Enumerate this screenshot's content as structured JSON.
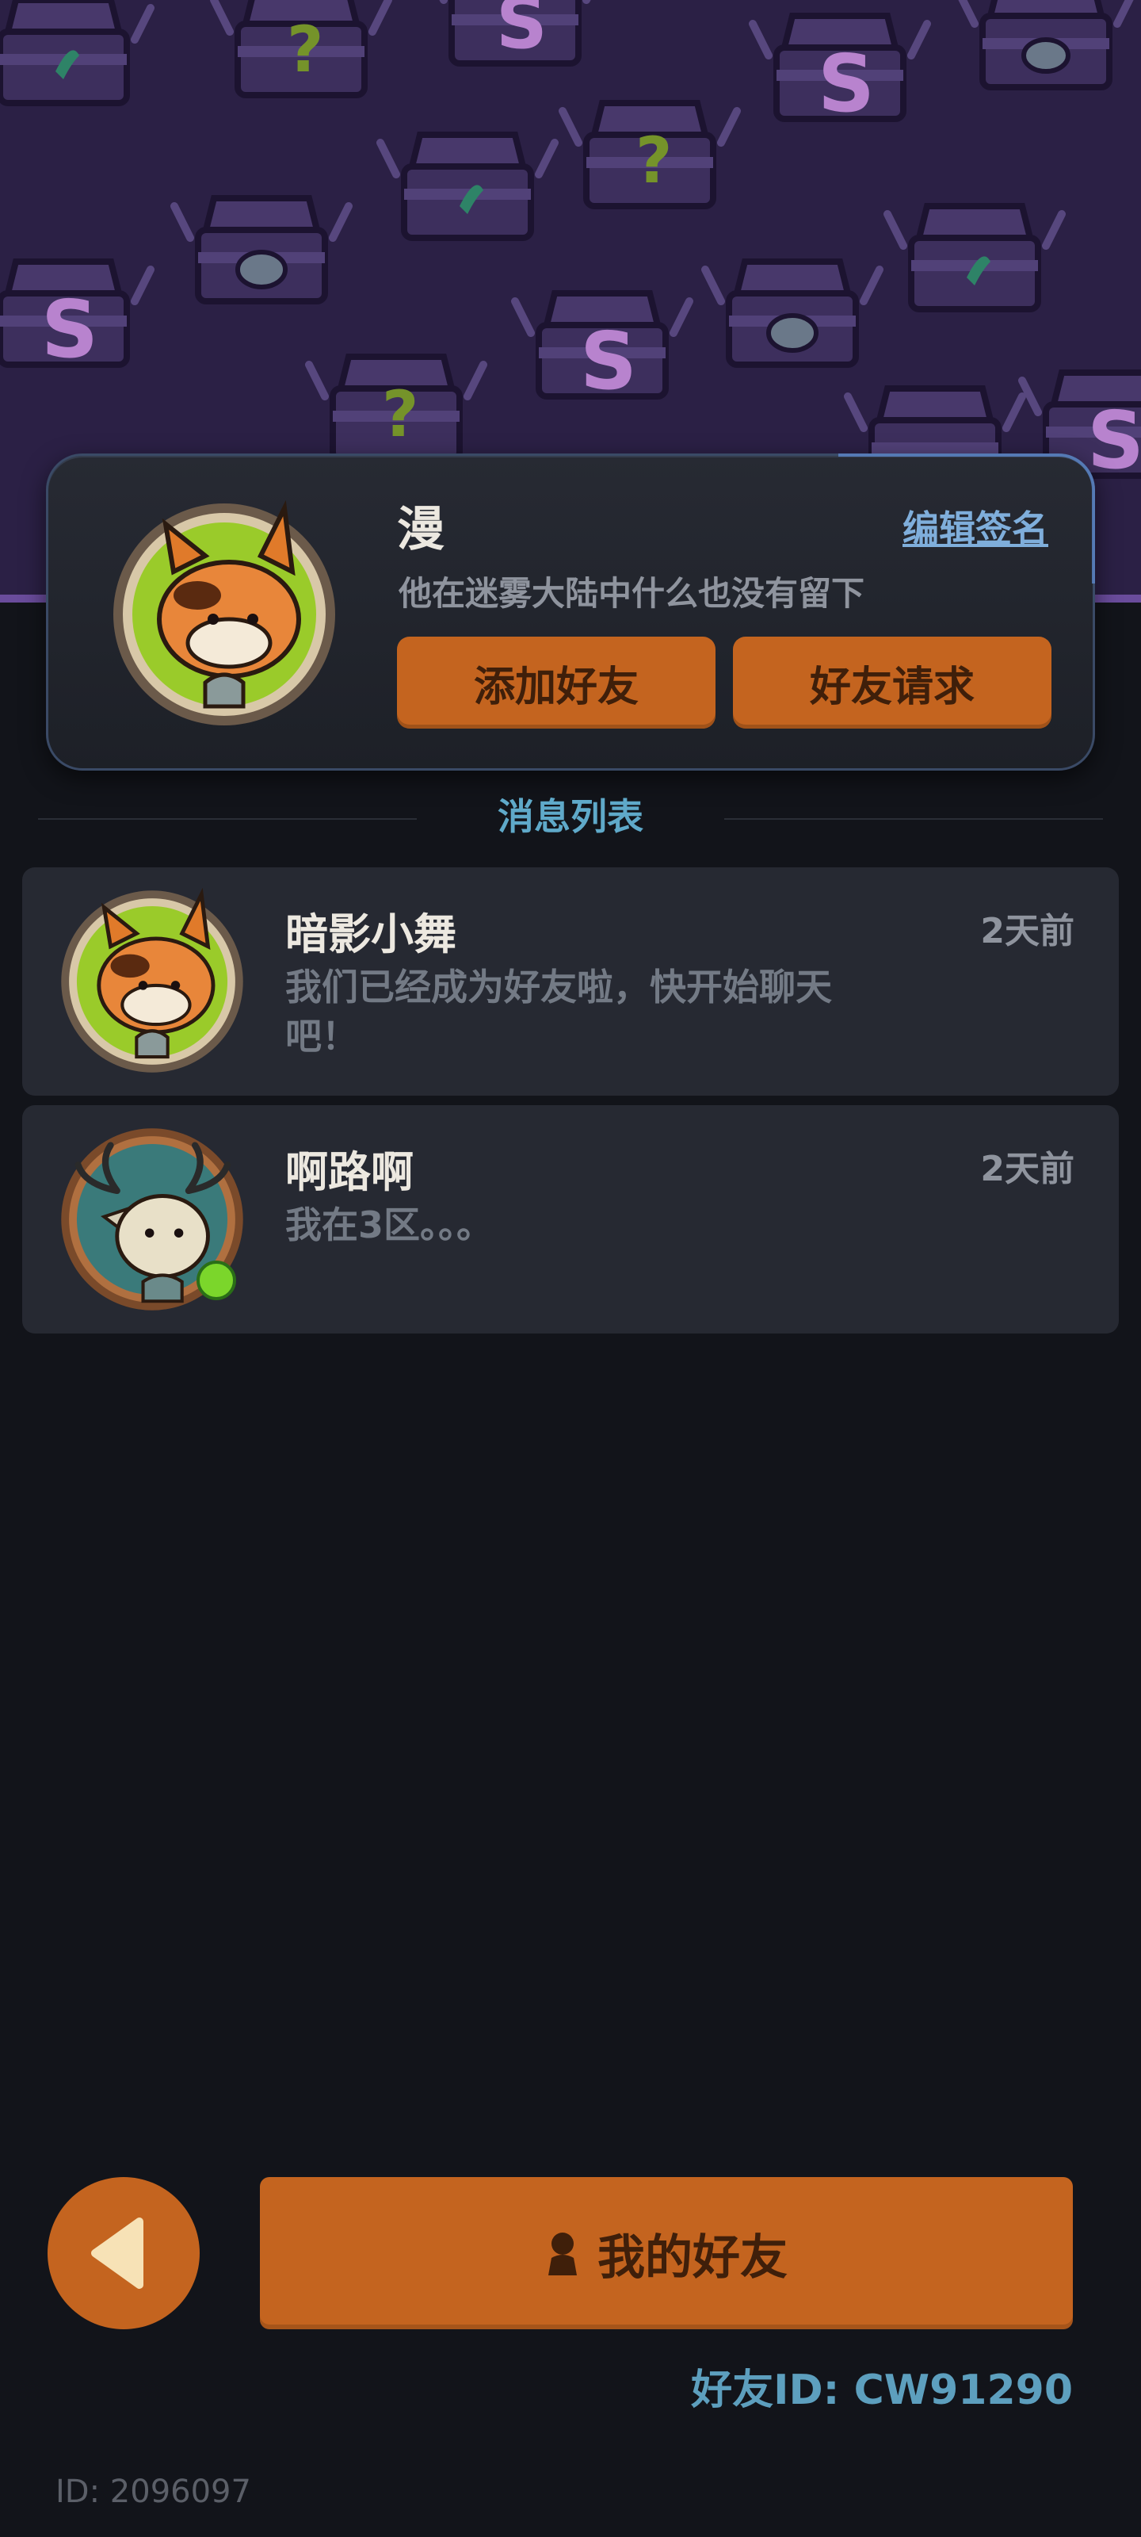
{
  "profile": {
    "name": "漫",
    "edit_signature_label": "编辑签名",
    "signature": "他在迷雾大陆中什么也没有留下",
    "add_friend_label": "添加好友",
    "friend_request_label": "好友请求"
  },
  "section_title": "消息列表",
  "messages": [
    {
      "name": "暗影小舞",
      "preview": "我们已经成为好友啦，快开始聊天吧！",
      "time": "2天前",
      "online": false
    },
    {
      "name": "啊路啊",
      "preview": "我在3区。。。",
      "time": "2天前",
      "online": true
    }
  ],
  "footer": {
    "my_friends_label": "我的好友",
    "friend_id": "好友ID: CW91290",
    "user_id": "ID: 2096097"
  },
  "colors": {
    "accent_orange": "#c4641f",
    "link_blue": "#7faedb",
    "section_teal": "#5fa9c9",
    "online_green": "#7bd62b",
    "banner_purple": "#2b2045"
  },
  "icons": [
    "fox-avatar",
    "deer-avatar",
    "back-arrow-icon",
    "person-icon",
    "treasure-chest-pattern"
  ]
}
